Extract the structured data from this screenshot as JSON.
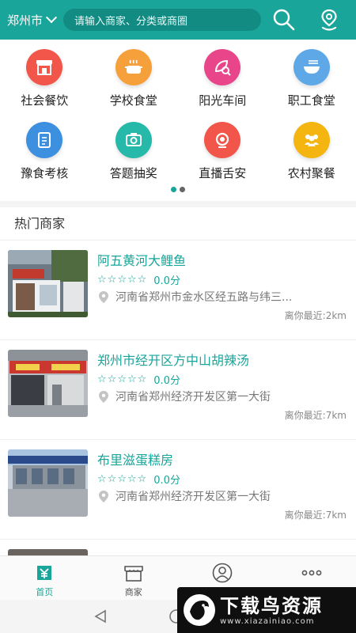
{
  "header": {
    "city": "郑州市",
    "search_placeholder": "请输入商家、分类或商圈"
  },
  "categories": [
    {
      "label": "社会餐饮",
      "icon": "storefront-icon",
      "color": "#f2564a"
    },
    {
      "label": "学校食堂",
      "icon": "cooking-pot-icon",
      "color": "#f6a03b"
    },
    {
      "label": "阳光车间",
      "icon": "leaf-search-icon",
      "color": "#e8458a"
    },
    {
      "label": "职工食堂",
      "icon": "food-bowl-icon",
      "color": "#5fa8e8"
    },
    {
      "label": "豫食考核",
      "icon": "exam-icon",
      "color": "#3d8fe0"
    },
    {
      "label": "答题抽奖",
      "icon": "camera-icon",
      "color": "#26b8a8"
    },
    {
      "label": "直播舌安",
      "icon": "live-broadcast-icon",
      "color": "#f2564a"
    },
    {
      "label": "农村聚餐",
      "icon": "group-people-icon",
      "color": "#f5b510"
    }
  ],
  "pager": {
    "active_index": 0,
    "total": 2
  },
  "hot": {
    "title": "热门商家",
    "items": [
      {
        "name": "阿五黄河大鲤鱼",
        "score": "0.0分",
        "address": "河南省郑州市金水区经五路与纬三...",
        "distance": "离你最近:2km"
      },
      {
        "name": "郑州市经开区方中山胡辣汤",
        "score": "0.0分",
        "address": "河南省郑州经济开发区第一大街",
        "distance": "离你最近:7km"
      },
      {
        "name": "布里滋蛋糕房",
        "score": "0.0分",
        "address": "河南省郑州经济开发区第一大街",
        "distance": "离你最近:7km"
      }
    ]
  },
  "nav": [
    {
      "label": "首页",
      "icon": "yuan-home-icon",
      "active": true
    },
    {
      "label": "商家",
      "icon": "shop-icon",
      "active": false
    },
    {
      "label": "我的",
      "icon": "user-icon",
      "active": false
    },
    {
      "label": "更多",
      "icon": "more-dots-icon",
      "active": false
    }
  ],
  "watermark": {
    "title": "下载鸟资源",
    "url": "www.xiazainiao.com"
  },
  "colors": {
    "accent": "#1aa59a",
    "accent_dark": "#128c83"
  }
}
